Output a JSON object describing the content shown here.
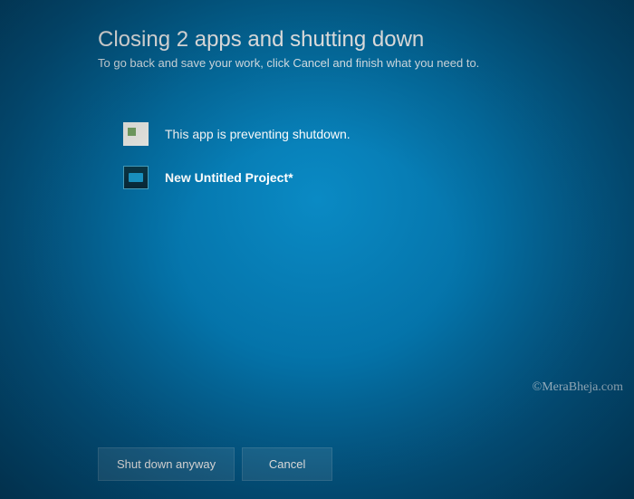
{
  "header": {
    "title": "Closing 2 apps and shutting down",
    "subtitle": "To go back and save your work, click Cancel and finish what you need to."
  },
  "apps": [
    {
      "icon": "blank-app-icon",
      "message": "This app is preventing shutdown.",
      "bold": false
    },
    {
      "icon": "video-editor-icon",
      "message": "New Untitled Project*",
      "bold": true
    }
  ],
  "buttons": {
    "shutdown_anyway": "Shut down anyway",
    "cancel": "Cancel"
  },
  "watermark": "©MeraBheja.com"
}
